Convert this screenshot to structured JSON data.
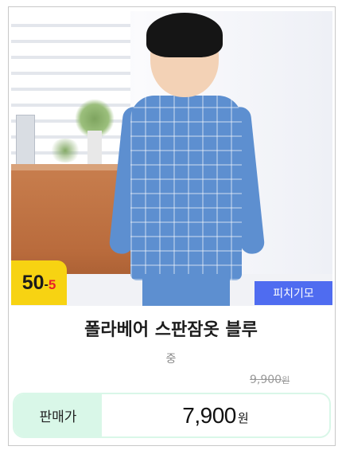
{
  "badge": {
    "discount_main": "50",
    "discount_sep": "-",
    "discount_sub": "5"
  },
  "tag": {
    "label": "피치기모"
  },
  "product": {
    "title": "폴라베어 스판잠옷 블루",
    "size": "중",
    "original_price": "9,900",
    "original_unit": "원",
    "sale_label": "판매가",
    "sale_price": "7,900",
    "sale_unit": "원"
  },
  "colors": {
    "badge_bg": "#f7d312",
    "badge_sub": "#e8202a",
    "tag_bg": "#4f6cf0",
    "price_label_bg": "#d9f7e8"
  }
}
